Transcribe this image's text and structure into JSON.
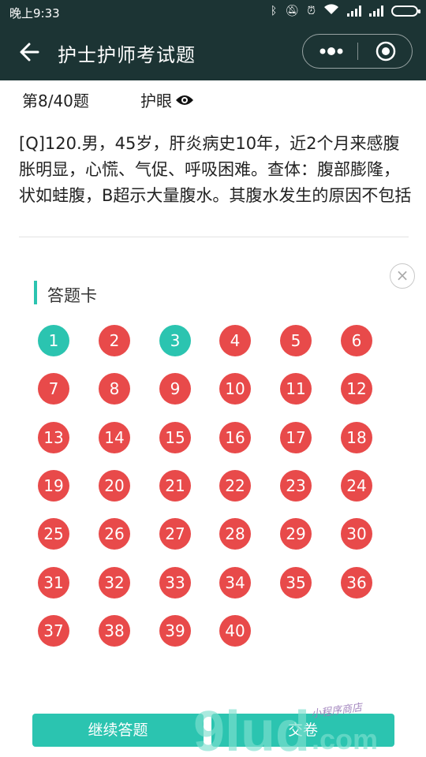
{
  "status_bar": {
    "time": "晚上9:33",
    "icons": [
      "bluetooth-icon",
      "mute-icon",
      "alarm-icon",
      "wifi-icon",
      "signal-icon",
      "signal-icon",
      "battery-icon"
    ]
  },
  "header": {
    "title": "护士护师考试题",
    "back_icon": "arrow-left-icon",
    "menu_icon": "more-dots-icon",
    "close_icon": "target-icon"
  },
  "info": {
    "counter": "第8/40题",
    "eye_mode": "护眼"
  },
  "question": {
    "text": "[Q]120.男，45岁，肝炎病史10年，近2个月来感腹胀明显，心慌、气促、呼吸困难。查体：腹部膨隆，状如蛙腹，B超示大量腹水。其腹水发生的原因不包括"
  },
  "answer_card": {
    "title": "答题卡",
    "close_glyph": "×",
    "numbers": [
      {
        "n": "1",
        "answered": true
      },
      {
        "n": "2",
        "answered": false
      },
      {
        "n": "3",
        "answered": true
      },
      {
        "n": "4",
        "answered": false
      },
      {
        "n": "5",
        "answered": false
      },
      {
        "n": "6",
        "answered": false
      },
      {
        "n": "7",
        "answered": false
      },
      {
        "n": "8",
        "answered": false
      },
      {
        "n": "9",
        "answered": false
      },
      {
        "n": "10",
        "answered": false
      },
      {
        "n": "11",
        "answered": false
      },
      {
        "n": "12",
        "answered": false
      },
      {
        "n": "13",
        "answered": false
      },
      {
        "n": "14",
        "answered": false
      },
      {
        "n": "15",
        "answered": false
      },
      {
        "n": "16",
        "answered": false
      },
      {
        "n": "17",
        "answered": false
      },
      {
        "n": "18",
        "answered": false
      },
      {
        "n": "19",
        "answered": false
      },
      {
        "n": "20",
        "answered": false
      },
      {
        "n": "21",
        "answered": false
      },
      {
        "n": "22",
        "answered": false
      },
      {
        "n": "23",
        "answered": false
      },
      {
        "n": "24",
        "answered": false
      },
      {
        "n": "25",
        "answered": false
      },
      {
        "n": "26",
        "answered": false
      },
      {
        "n": "27",
        "answered": false
      },
      {
        "n": "28",
        "answered": false
      },
      {
        "n": "29",
        "answered": false
      },
      {
        "n": "30",
        "answered": false
      },
      {
        "n": "31",
        "answered": false
      },
      {
        "n": "32",
        "answered": false
      },
      {
        "n": "33",
        "answered": false
      },
      {
        "n": "34",
        "answered": false
      },
      {
        "n": "35",
        "answered": false
      },
      {
        "n": "36",
        "answered": false
      },
      {
        "n": "37",
        "answered": false
      },
      {
        "n": "38",
        "answered": false
      },
      {
        "n": "39",
        "answered": false
      },
      {
        "n": "40",
        "answered": false
      }
    ],
    "continue_label": "继续答题",
    "submit_label": "交卷"
  },
  "colors": {
    "header_bg": "#1c3434",
    "answered": "#2bc4b0",
    "unanswered": "#e84a4a",
    "button": "#2bc4b0"
  },
  "watermark": {
    "text": "9lud.com",
    "script_text": "小程序商店"
  }
}
